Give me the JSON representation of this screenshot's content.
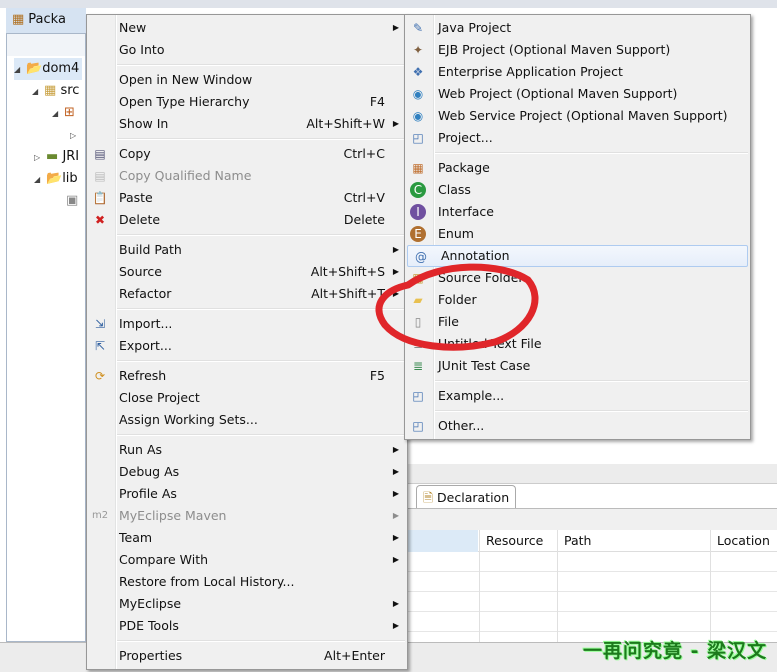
{
  "explorer": {
    "tab_label": "Packa",
    "tree": [
      "dom4",
      "src",
      "JRI",
      "lib"
    ]
  },
  "context_menu": [
    {
      "label": "New",
      "arrow": true
    },
    {
      "label": "Go Into"
    },
    {
      "sep": true
    },
    {
      "label": "Open in New Window"
    },
    {
      "label": "Open Type Hierarchy",
      "shortcut": "F4"
    },
    {
      "label": "Show In",
      "shortcut": "Alt+Shift+W",
      "arrow": true
    },
    {
      "sep": true
    },
    {
      "label": "Copy",
      "shortcut": "Ctrl+C",
      "icon": "copy-icon"
    },
    {
      "label": "Copy Qualified Name",
      "disabled": true,
      "icon": "copy-qualified-icon"
    },
    {
      "label": "Paste",
      "shortcut": "Ctrl+V",
      "icon": "paste-icon"
    },
    {
      "label": "Delete",
      "shortcut": "Delete",
      "icon": "delete-icon"
    },
    {
      "sep": true
    },
    {
      "label": "Build Path",
      "arrow": true
    },
    {
      "label": "Source",
      "shortcut": "Alt+Shift+S",
      "arrow": true
    },
    {
      "label": "Refactor",
      "shortcut": "Alt+Shift+T",
      "arrow": true
    },
    {
      "sep": true
    },
    {
      "label": "Import...",
      "icon": "import-icon"
    },
    {
      "label": "Export...",
      "icon": "export-icon"
    },
    {
      "sep": true
    },
    {
      "label": "Refresh",
      "shortcut": "F5",
      "icon": "refresh-icon"
    },
    {
      "label": "Close Project"
    },
    {
      "label": "Assign Working Sets..."
    },
    {
      "sep": true
    },
    {
      "label": "Run As",
      "arrow": true
    },
    {
      "label": "Debug As",
      "arrow": true
    },
    {
      "label": "Profile As",
      "arrow": true
    },
    {
      "label": "MyEclipse Maven",
      "arrow": true,
      "disabled": true,
      "icon": "m2-icon"
    },
    {
      "label": "Team",
      "arrow": true
    },
    {
      "label": "Compare With",
      "arrow": true
    },
    {
      "label": "Restore from Local History..."
    },
    {
      "label": "MyEclipse",
      "arrow": true
    },
    {
      "label": "PDE Tools",
      "arrow": true
    },
    {
      "sep": true
    },
    {
      "label": "Properties",
      "shortcut": "Alt+Enter"
    }
  ],
  "new_submenu": [
    {
      "label": "Java Project",
      "icon": "java-project-icon"
    },
    {
      "label": "EJB Project (Optional Maven Support)",
      "icon": "ejb-project-icon"
    },
    {
      "label": "Enterprise Application Project",
      "icon": "enterprise-project-icon"
    },
    {
      "label": "Web Project (Optional Maven Support)",
      "icon": "web-project-icon"
    },
    {
      "label": "Web Service Project (Optional Maven Support)",
      "icon": "web-service-project-icon"
    },
    {
      "label": "Project...",
      "icon": "project-icon"
    },
    {
      "sep": true
    },
    {
      "label": "Package",
      "icon": "package-icon"
    },
    {
      "label": "Class",
      "icon": "class-icon"
    },
    {
      "label": "Interface",
      "icon": "interface-icon"
    },
    {
      "label": "Enum",
      "icon": "enum-icon"
    },
    {
      "label": "Annotation",
      "icon": "annotation-icon",
      "highlighted": true
    },
    {
      "label": "Source Folder",
      "icon": "source-folder-icon"
    },
    {
      "label": "Folder",
      "icon": "folder-icon"
    },
    {
      "label": "File",
      "icon": "file-icon"
    },
    {
      "label": "Untitled Text File",
      "icon": "text-file-icon"
    },
    {
      "label": "JUnit Test Case",
      "icon": "junit-icon"
    },
    {
      "sep": true
    },
    {
      "label": "Example...",
      "icon": "example-icon"
    },
    {
      "sep": true
    },
    {
      "label": "Other...",
      "icon": "other-icon"
    }
  ],
  "bottom_panel": {
    "tab": "Declaration",
    "columns": [
      "Resource",
      "Path",
      "Location"
    ]
  },
  "watermark": "一再问究竟 - 梁汉文",
  "annotation_color": "#e0262a"
}
